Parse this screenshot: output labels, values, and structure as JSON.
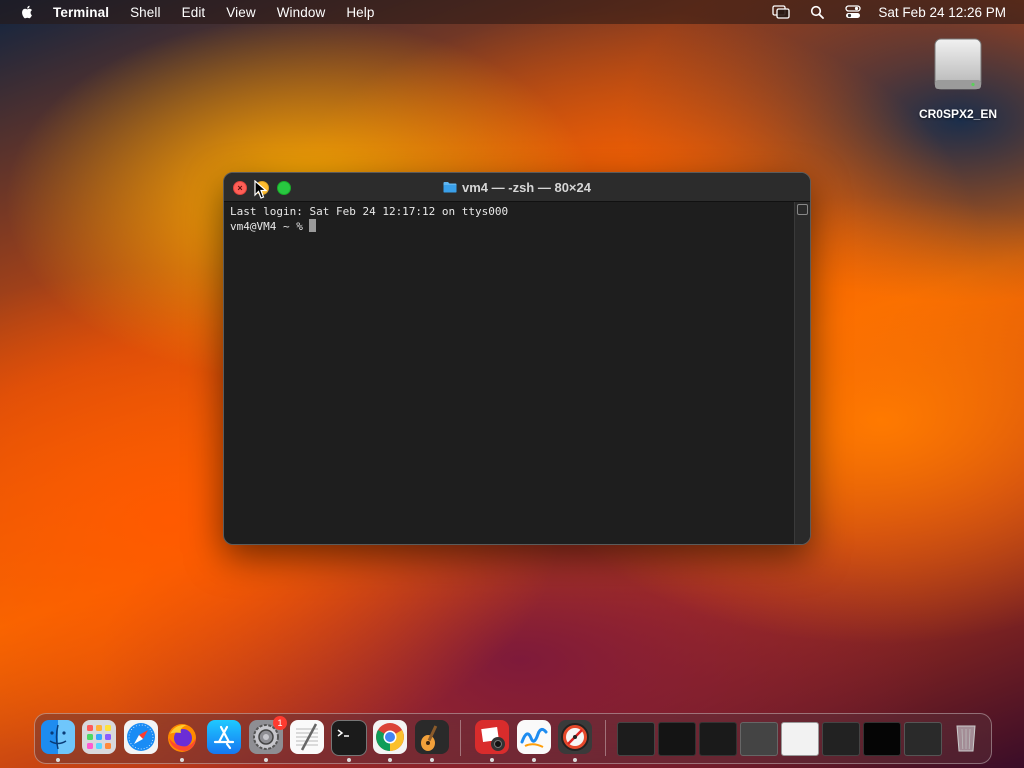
{
  "menubar": {
    "app_name": "Terminal",
    "items": [
      "Shell",
      "Edit",
      "View",
      "Window",
      "Help"
    ],
    "clock": "Sat Feb 24  12:26 PM"
  },
  "desktop": {
    "drive_label": "CR0SPX2_EN"
  },
  "window": {
    "title": "vm4 — -zsh — 80×24",
    "lines": [
      "Last login: Sat Feb 24 12:17:12 on ttys000",
      "vm4@VM4 ~ % "
    ]
  },
  "dock": {
    "settings_badge": "1",
    "apps": [
      "finder-icon",
      "launchpad-icon",
      "safari-icon",
      "firefox-icon",
      "app-store-icon",
      "system-settings-icon",
      "textedit-icon",
      "terminal-icon",
      "chrome-icon",
      "garageband-icon",
      "photo-booth-icon",
      "freeform-icon",
      "compass-icon"
    ]
  },
  "colors": {
    "close": "#ff5f57",
    "minimize": "#febc2e",
    "zoom": "#28c840",
    "terminal_bg": "#1e1e1e"
  }
}
